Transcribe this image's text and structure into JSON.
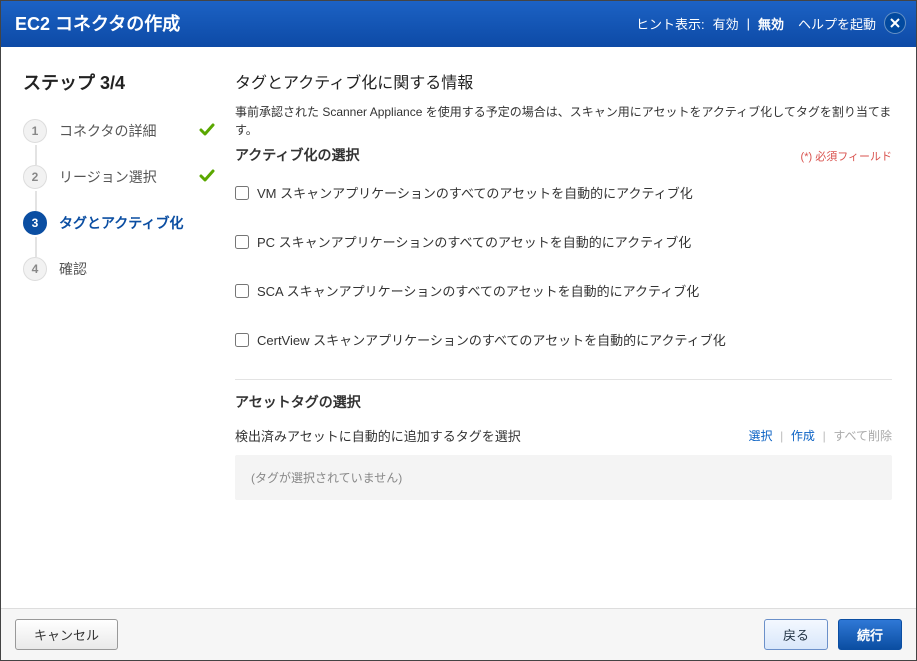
{
  "dialog": {
    "title": "EC2 コネクタの作成",
    "hint_label": "ヒント表示:",
    "hint_on": "有効",
    "hint_off": "無効",
    "help_link": "ヘルプを起動"
  },
  "wizard": {
    "step_title": "ステップ 3/4",
    "steps": [
      {
        "num": "1",
        "label": "コネクタの詳細",
        "done": true,
        "active": false
      },
      {
        "num": "2",
        "label": "リージョン選択",
        "done": true,
        "active": false
      },
      {
        "num": "3",
        "label": "タグとアクティブ化",
        "done": false,
        "active": true
      },
      {
        "num": "4",
        "label": "確認",
        "done": false,
        "active": false
      }
    ]
  },
  "main": {
    "heading": "タグとアクティブ化に関する情報",
    "description": "事前承認された Scanner Appliance を使用する予定の場合は、スキャン用にアセットをアクティブ化してタグを割り当てます。",
    "activation_section": "アクティブ化の選択",
    "required_note": "(*) 必須フィールド",
    "checkboxes": [
      {
        "label": "VM スキャンアプリケーションのすべてのアセットを自動的にアクティブ化"
      },
      {
        "label": "PC スキャンアプリケーションのすべてのアセットを自動的にアクティブ化"
      },
      {
        "label": "SCA スキャンアプリケーションのすべてのアセットを自動的にアクティブ化"
      },
      {
        "label": "CertView スキャンアプリケーションのすべてのアセットを自動的にアクティブ化"
      }
    ],
    "tag_section": "アセットタグの選択",
    "tag_hint": "検出済みアセットに自動的に追加するタグを選択",
    "tag_select": "選択",
    "tag_create": "作成",
    "tag_delete_all": "すべて削除",
    "tag_empty": "(タグが選択されていません)"
  },
  "footer": {
    "cancel": "キャンセル",
    "back": "戻る",
    "continue": "続行"
  }
}
